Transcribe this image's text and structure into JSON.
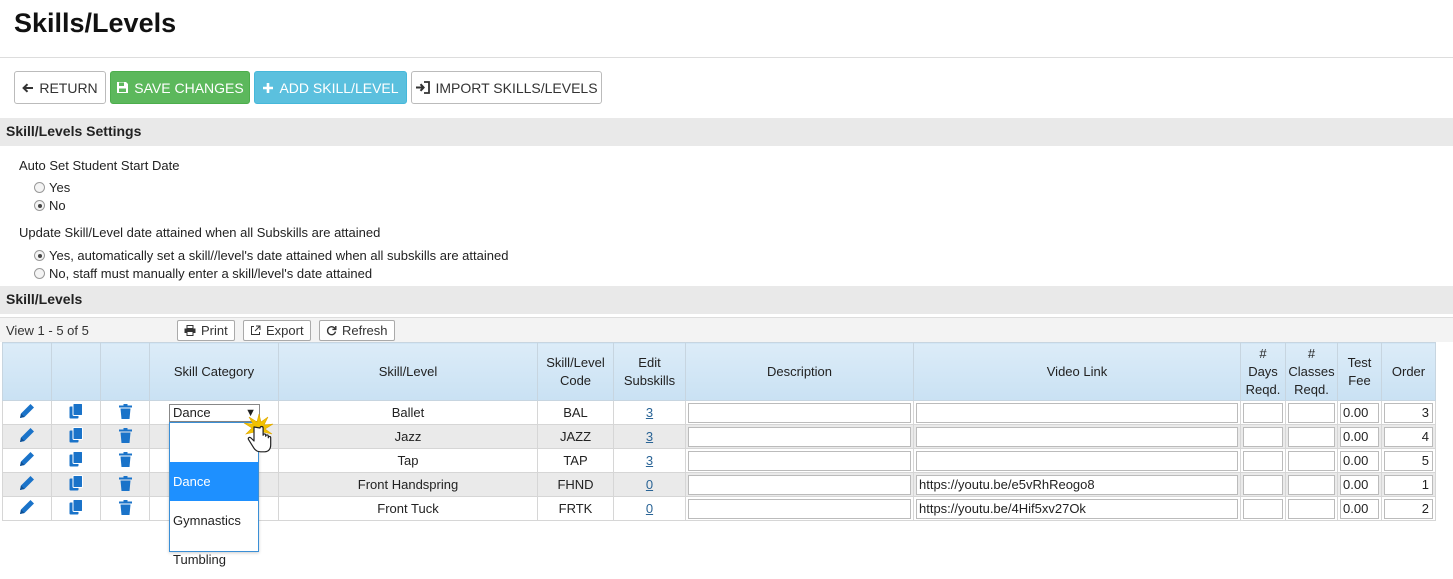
{
  "page": {
    "title": "Skills/Levels"
  },
  "toolbar": {
    "return_label": "RETURN",
    "save_label": "SAVE CHANGES",
    "add_label": "ADD SKILL/LEVEL",
    "import_label": "IMPORT SKILLS/LEVELS"
  },
  "settings": {
    "title": "Skill/Levels Settings",
    "auto_start": {
      "label": "Auto Set Student Start Date",
      "yes": "Yes",
      "no": "No",
      "selected": "No"
    },
    "update_attained": {
      "label": "Update Skill/Level date attained when all Subskills are attained",
      "yes": "Yes, automatically set a skill//level's date attained when all subskills are attained",
      "no": "No, staff must manually enter a skill/level's date attained",
      "selected": "yes"
    }
  },
  "grid": {
    "section_title": "Skill/Levels",
    "view_count": "View 1 - 5 of 5",
    "print_label": "Print",
    "export_label": "Export",
    "refresh_label": "Refresh",
    "columns": {
      "category": "Skill Category",
      "skill": "Skill/Level",
      "code_line1": "Skill/Level",
      "code_line2": "Code",
      "subs_line1": "Edit",
      "subs_line2": "Subskills",
      "description": "Description",
      "video": "Video Link",
      "days_line1": "#",
      "days_line2": "Days",
      "days_line3": "Reqd.",
      "classes_line1": "#",
      "classes_line2": "Classes",
      "classes_line3": "Reqd.",
      "fee_line1": "Test",
      "fee_line2": "Fee",
      "order": "Order"
    },
    "rows": [
      {
        "category": "Dance",
        "skill": "Ballet",
        "code": "BAL",
        "subskills": "3",
        "description": "",
        "video": "",
        "days": "",
        "classes": "",
        "fee": "0.00",
        "order": "3"
      },
      {
        "category": "",
        "skill": "Jazz",
        "code": "JAZZ",
        "subskills": "3",
        "description": "",
        "video": "",
        "days": "",
        "classes": "",
        "fee": "0.00",
        "order": "4"
      },
      {
        "category": "",
        "skill": "Tap",
        "code": "TAP",
        "subskills": "3",
        "description": "",
        "video": "",
        "days": "",
        "classes": "",
        "fee": "0.00",
        "order": "5"
      },
      {
        "category": "",
        "skill": "Front Handspring",
        "code": "FHND",
        "subskills": "0",
        "description": "",
        "video": "https://youtu.be/e5vRhReogo8",
        "days": "",
        "classes": "",
        "fee": "0.00",
        "order": "1"
      },
      {
        "category": "",
        "skill": "Front Tuck",
        "code": "FRTK",
        "subskills": "0",
        "description": "",
        "video": "https://youtu.be/4Hif5xv27Ok",
        "days": "",
        "classes": "",
        "fee": "0.00",
        "order": "2"
      }
    ]
  },
  "dropdown": {
    "arrow": "▼",
    "options": [
      "Dance",
      "Gymnastics",
      "Tumbling"
    ],
    "highlighted": "Dance"
  },
  "colors": {
    "save": "#5cb85c",
    "add": "#5bc0de",
    "icon_blue": "#1a73c9",
    "highlight": "#1e90ff"
  }
}
